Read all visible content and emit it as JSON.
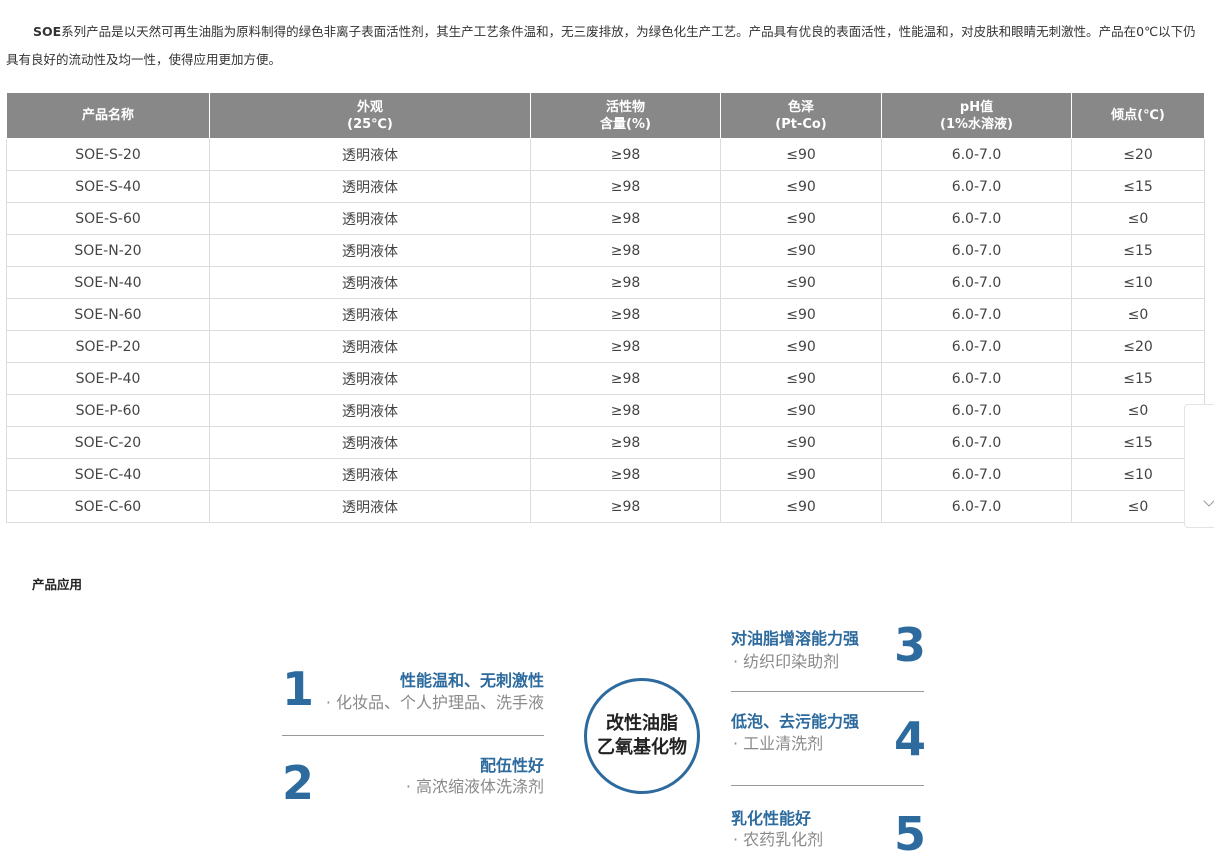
{
  "intro": {
    "brand": "SOE",
    "text": "系列产品是以天然可再生油脂为原料制得的绿色非离子表面活性剂，其生产工艺条件温和，无三废排放，为绿色化生产工艺。产品具有优良的表面活性，性能温和，对皮肤和眼睛无刺激性。产品在0℃以下仍具有良好的流动性及均一性，使得应用更加方便。"
  },
  "table": {
    "headers": [
      "产品名称",
      "外观\n(25℃)",
      "活性物\n含量(%)",
      "色泽\n(Pt-Co)",
      "pH值\n(1%水溶液)",
      "倾点(℃)"
    ],
    "rows": [
      [
        "SOE-S-20",
        "透明液体",
        "≥98",
        "≤90",
        "6.0-7.0",
        "≤20"
      ],
      [
        "SOE-S-40",
        "透明液体",
        "≥98",
        "≤90",
        "6.0-7.0",
        "≤15"
      ],
      [
        "SOE-S-60",
        "透明液体",
        "≥98",
        "≤90",
        "6.0-7.0",
        "≤0"
      ],
      [
        "SOE-N-20",
        "透明液体",
        "≥98",
        "≤90",
        "6.0-7.0",
        "≤15"
      ],
      [
        "SOE-N-40",
        "透明液体",
        "≥98",
        "≤90",
        "6.0-7.0",
        "≤10"
      ],
      [
        "SOE-N-60",
        "透明液体",
        "≥98",
        "≤90",
        "6.0-7.0",
        "≤0"
      ],
      [
        "SOE-P-20",
        "透明液体",
        "≥98",
        "≤90",
        "6.0-7.0",
        "≤20"
      ],
      [
        "SOE-P-40",
        "透明液体",
        "≥98",
        "≤90",
        "6.0-7.0",
        "≤15"
      ],
      [
        "SOE-P-60",
        "透明液体",
        "≥98",
        "≤90",
        "6.0-7.0",
        "≤0"
      ],
      [
        "SOE-C-20",
        "透明液体",
        "≥98",
        "≤90",
        "6.0-7.0",
        "≤15"
      ],
      [
        "SOE-C-40",
        "透明液体",
        "≥98",
        "≤90",
        "6.0-7.0",
        "≤10"
      ],
      [
        "SOE-C-60",
        "透明液体",
        "≥98",
        "≤90",
        "6.0-7.0",
        "≤0"
      ]
    ]
  },
  "applications": {
    "title": "产品应用",
    "center": [
      "改性油脂",
      "乙氧基化物"
    ],
    "items": [
      {
        "num": "1",
        "feature": "性能温和、无刺激性",
        "use": "· 化妆品、个人护理品、洗手液"
      },
      {
        "num": "2",
        "feature": "配伍性好",
        "use": "· 高浓缩液体洗涤剂"
      },
      {
        "num": "3",
        "feature": "对油脂增溶能力强",
        "use": "· 纺织印染助剂"
      },
      {
        "num": "4",
        "feature": "低泡、去污能力强",
        "use": "· 工业清洗剂"
      },
      {
        "num": "5",
        "feature": "乳化性能好",
        "use": "· 农药乳化剂"
      }
    ]
  },
  "colors": {
    "accent": "#2d6b9e",
    "header_bg": "#888888"
  }
}
